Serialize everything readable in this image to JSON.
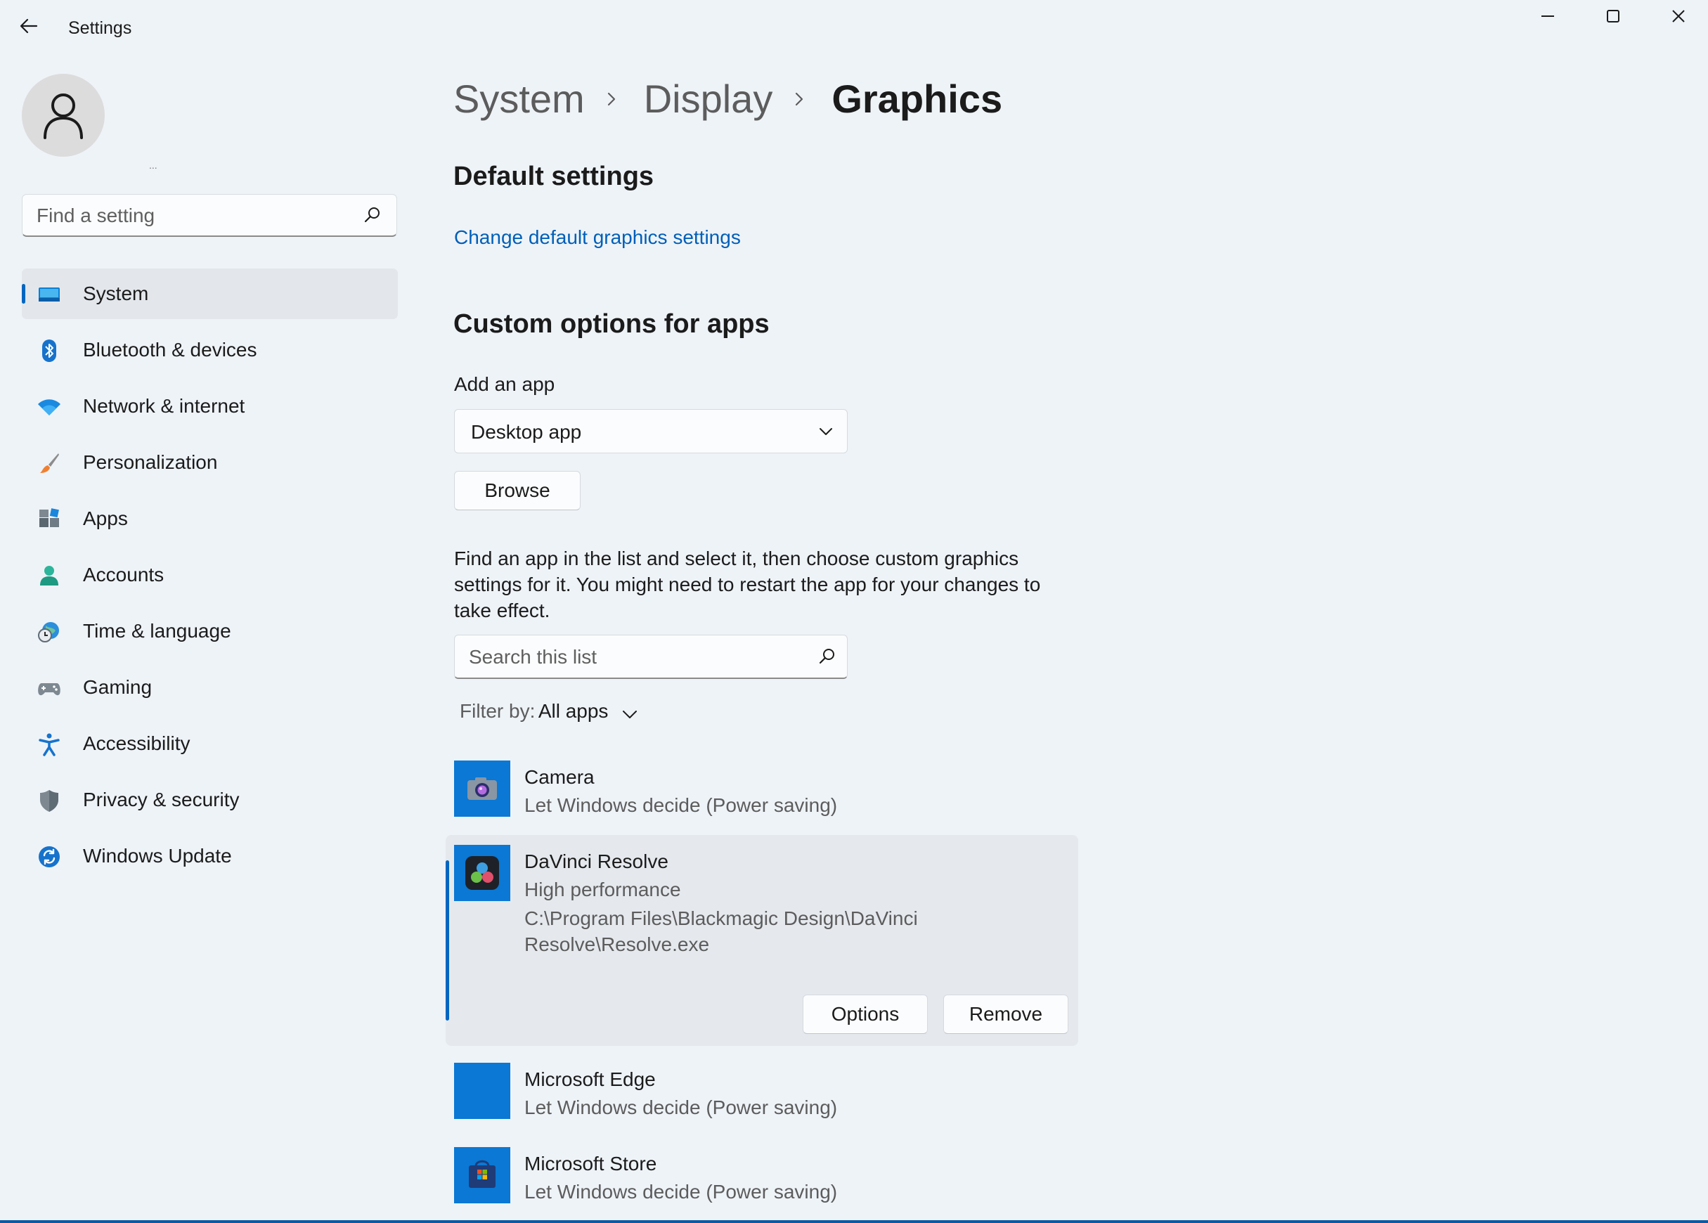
{
  "window": {
    "title": "Settings"
  },
  "user": {
    "name_placeholder": "..."
  },
  "search": {
    "placeholder": "Find a setting"
  },
  "sidebar": {
    "items": [
      {
        "label": "System",
        "icon": "monitor-icon",
        "active": true
      },
      {
        "label": "Bluetooth & devices",
        "icon": "bluetooth-icon",
        "active": false
      },
      {
        "label": "Network & internet",
        "icon": "wifi-icon",
        "active": false
      },
      {
        "label": "Personalization",
        "icon": "brush-icon",
        "active": false
      },
      {
        "label": "Apps",
        "icon": "apps-icon",
        "active": false
      },
      {
        "label": "Accounts",
        "icon": "person-icon",
        "active": false
      },
      {
        "label": "Time & language",
        "icon": "globe-clock-icon",
        "active": false
      },
      {
        "label": "Gaming",
        "icon": "gamepad-icon",
        "active": false
      },
      {
        "label": "Accessibility",
        "icon": "accessibility-icon",
        "active": false
      },
      {
        "label": "Privacy & security",
        "icon": "shield-icon",
        "active": false
      },
      {
        "label": "Windows Update",
        "icon": "update-icon",
        "active": false
      }
    ]
  },
  "breadcrumb": {
    "items": [
      "System",
      "Display",
      "Graphics"
    ]
  },
  "default_settings": {
    "heading": "Default settings",
    "link": "Change default graphics settings"
  },
  "custom": {
    "heading": "Custom options for apps",
    "add_app_label": "Add an app",
    "app_type": "Desktop app",
    "browse_label": "Browse",
    "help_text": "Find an app in the list and select it, then choose custom graphics settings for it. You might need to restart the app for your changes to take effect.",
    "list_search_placeholder": "Search this list",
    "filter_label": "Filter by:",
    "filter_value": "All apps"
  },
  "apps": [
    {
      "name": "Camera",
      "setting": "Let Windows decide (Power saving)",
      "icon": "camera-icon"
    },
    {
      "name": "DaVinci Resolve",
      "setting": "High performance",
      "path": "C:\\Program Files\\Blackmagic Design\\DaVinci Resolve\\Resolve.exe",
      "icon": "davinci-resolve-icon",
      "selected": true,
      "options_label": "Options",
      "remove_label": "Remove"
    },
    {
      "name": "Microsoft Edge",
      "setting": "Let Windows decide (Power saving)",
      "icon": "edge-icon"
    },
    {
      "name": "Microsoft Store",
      "setting": "Let Windows decide (Power saving)",
      "icon": "store-icon"
    }
  ],
  "colors": {
    "accent": "#0067c0",
    "link": "#005fb8",
    "tile": "#0a78d4",
    "background": "#eef3f8"
  }
}
